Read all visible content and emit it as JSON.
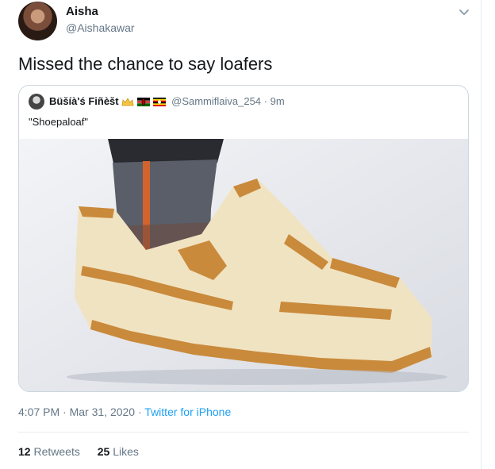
{
  "tweet": {
    "author_name": "Aisha",
    "author_handle": "@Aishakawar",
    "text": "Missed the chance to say loafers",
    "time": "4:07 PM",
    "separator": " · ",
    "date": "Mar 31, 2020",
    "source": "Twitter for iPhone",
    "retweets_count": "12",
    "retweets_label": "Retweets",
    "likes_count": "25",
    "likes_label": "Likes"
  },
  "quoted_tweet": {
    "author_name": "Büšíà'ś Fiñèšt",
    "author_handle": "@Sammiflaiva_254",
    "timestamp": "9m",
    "text": "\"Shoepaloaf\"",
    "media_icon": "bread-sneaker-photo"
  },
  "icons": {
    "menu": "chevron-down-icon",
    "flags": [
      "crown-emoji",
      "kenya-flag",
      "uganda-flag"
    ]
  },
  "colors": {
    "accent": "#1da1f2",
    "secondary_text": "#657786",
    "border": "#ccd6dd"
  }
}
